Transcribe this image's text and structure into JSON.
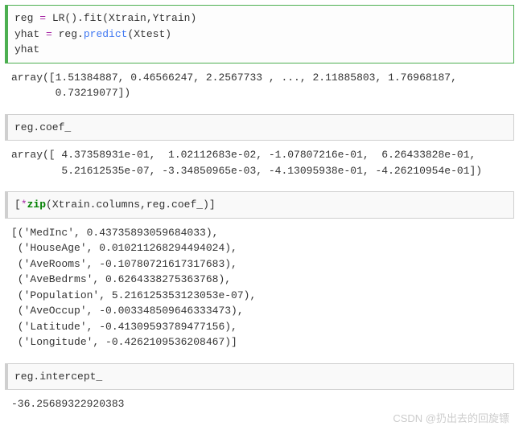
{
  "cells": [
    {
      "type": "code_active",
      "lines": [
        [
          {
            "t": "reg ",
            "c": "tok-var"
          },
          {
            "t": "=",
            "c": "tok-op"
          },
          {
            "t": " LR().fit(Xtrain,Ytrain)",
            "c": "tok-func"
          }
        ],
        [
          {
            "t": "yhat ",
            "c": "tok-var"
          },
          {
            "t": "=",
            "c": "tok-op"
          },
          {
            "t": " reg.",
            "c": "tok-func"
          },
          {
            "t": "predict",
            "c": "tok-call"
          },
          {
            "t": "(Xtest)",
            "c": "tok-func"
          }
        ],
        [
          {
            "t": "yhat",
            "c": "tok-var"
          }
        ]
      ]
    },
    {
      "type": "output",
      "text": "array([1.51384887, 0.46566247, 2.2567733 , ..., 2.11885803, 1.76968187,\n       0.73219077])"
    },
    {
      "type": "code",
      "lines": [
        [
          {
            "t": "reg.coef_",
            "c": "tok-var"
          }
        ]
      ]
    },
    {
      "type": "output",
      "text": "array([ 4.37358931e-01,  1.02112683e-02, -1.07807216e-01,  6.26433828e-01,\n        5.21612535e-07, -3.34850965e-03, -4.13095938e-01, -4.26210954e-01])"
    },
    {
      "type": "code",
      "lines": [
        [
          {
            "t": "[",
            "c": "tok-func"
          },
          {
            "t": "*",
            "c": "tok-op"
          },
          {
            "t": "zip",
            "c": "tok-kw"
          },
          {
            "t": "(Xtrain.columns,reg.coef_)]",
            "c": "tok-func"
          }
        ]
      ]
    },
    {
      "type": "output",
      "text": "[('MedInc', 0.43735893059684033),\n ('HouseAge', 0.010211268294494024),\n ('AveRooms', -0.10780721617317683),\n ('AveBedrms', 0.6264338275363768),\n ('Population', 5.216125353123053e-07),\n ('AveOccup', -0.003348509646333473),\n ('Latitude', -0.41309593789477156),\n ('Longitude', -0.4262109536208467)]"
    },
    {
      "type": "code",
      "lines": [
        [
          {
            "t": "reg.intercept_",
            "c": "tok-var"
          }
        ]
      ]
    },
    {
      "type": "output",
      "text": "-36.25689322920383"
    }
  ],
  "watermark": "CSDN @扔出去的回旋镖"
}
